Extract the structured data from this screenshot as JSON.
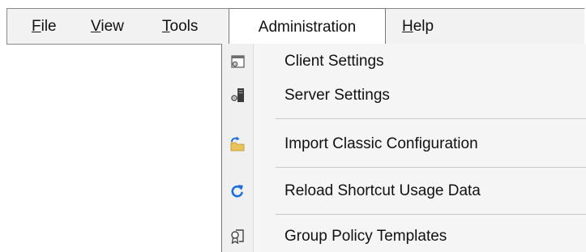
{
  "menubar": {
    "items": [
      {
        "label": "File",
        "mnemonic": "F",
        "rest": "ile"
      },
      {
        "label": "View",
        "mnemonic": "V",
        "rest": "iew"
      },
      {
        "label": "Tools",
        "mnemonic": "T",
        "rest": "ools"
      },
      {
        "label": "Administration",
        "mnemonic": "",
        "rest": "Administration"
      },
      {
        "label": "Help",
        "mnemonic": "H",
        "rest": "elp"
      }
    ],
    "active_item": "Administration"
  },
  "dropdown": {
    "items": [
      {
        "label": "Client Settings",
        "icon": "client-settings-icon"
      },
      {
        "label": "Server Settings",
        "icon": "server-settings-icon"
      },
      {
        "label": "Import Classic Configuration",
        "icon": "import-folder-icon"
      },
      {
        "label": "Reload Shortcut Usage Data",
        "icon": "reload-icon"
      },
      {
        "label": "Group Policy Templates",
        "icon": "group-policy-icon"
      }
    ]
  },
  "colors": {
    "menubar_bg": "#f2f2f2",
    "dropdown_bg": "#f5f5f5",
    "accent_blue": "#1e6fd9",
    "folder_yellow": "#e8c25a"
  }
}
